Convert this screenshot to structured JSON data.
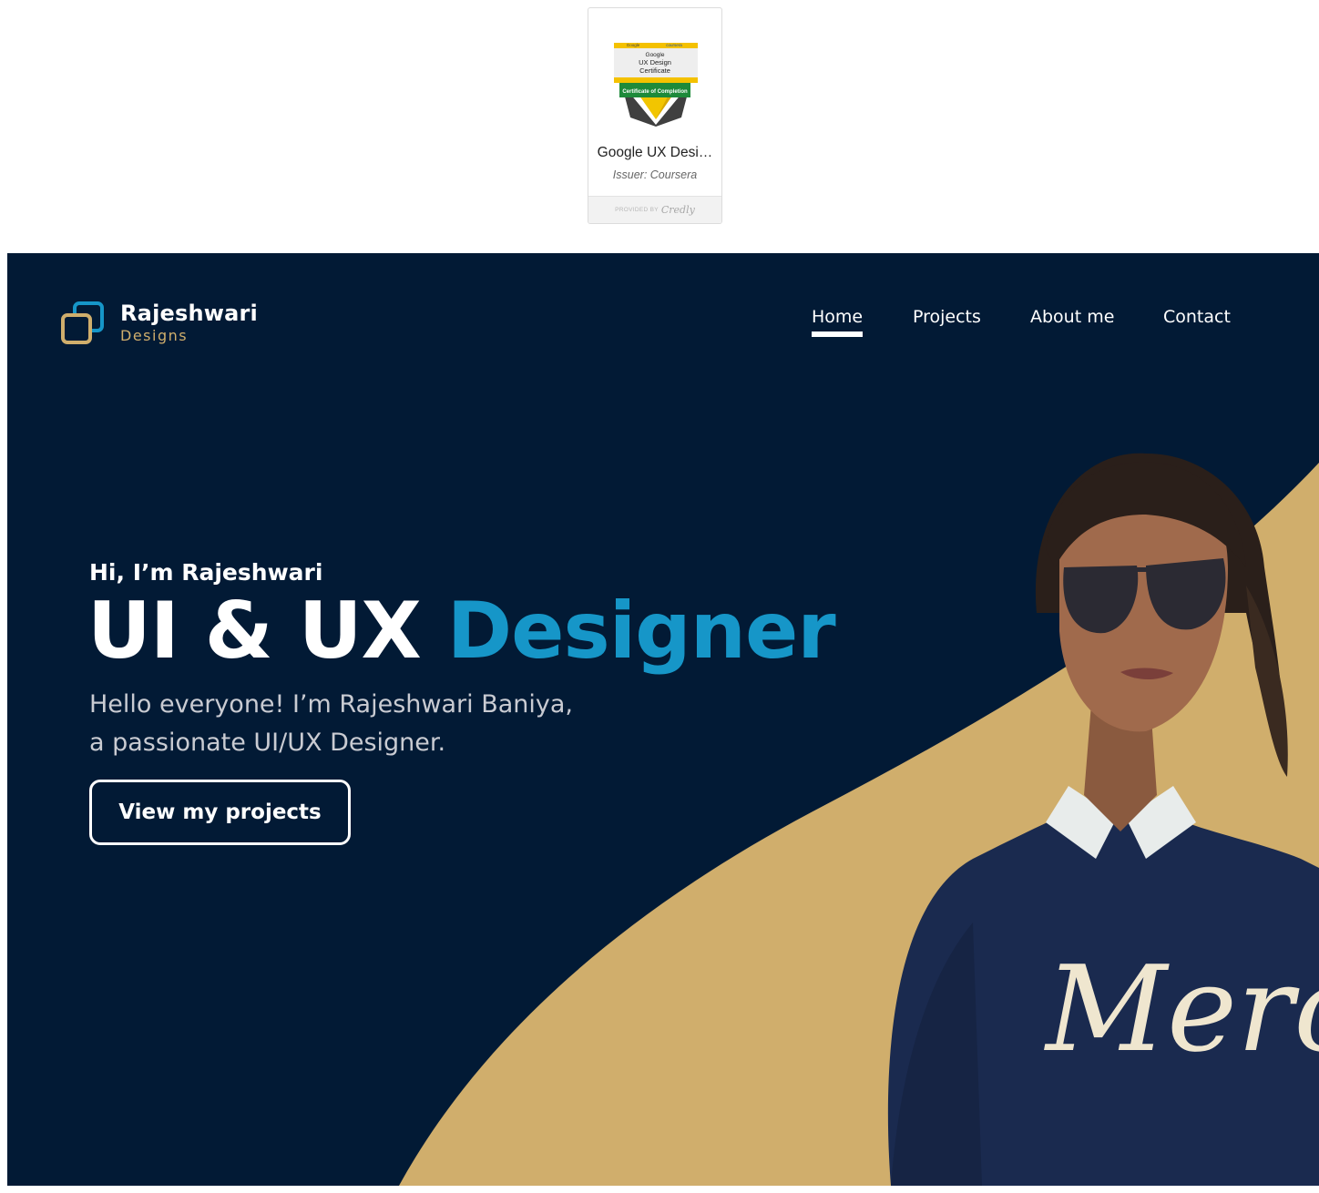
{
  "badge": {
    "image_lines": [
      "Google",
      "coursera",
      "Google",
      "UX Design",
      "Certificate",
      "Certificate of Completion"
    ],
    "name": "Google UX Desi…",
    "issuer": "Issuer: Coursera",
    "provided_by": "PROVIDED BY",
    "provider": "Credly"
  },
  "header": {
    "logo_name": "Rajeshwari",
    "logo_sub": "Designs",
    "nav": [
      {
        "label": "Home",
        "active": true
      },
      {
        "label": "Projects",
        "active": false
      },
      {
        "label": "About me",
        "active": false
      },
      {
        "label": "Contact",
        "active": false
      }
    ]
  },
  "hero": {
    "greeting": "Hi, I’m Rajeshwari",
    "headline_part1": "UI & UX ",
    "headline_part2": "Designer",
    "intro_line1": "Hello everyone! I’m Rajeshwari Baniya,",
    "intro_line2": "a passionate UI/UX Designer.",
    "cta_label": "View my projects",
    "sweater_text": "Merci"
  },
  "colors": {
    "hero_bg": "#021a35",
    "accent_gold": "#d0ae6c",
    "accent_blue": "#1696c8",
    "text_white": "#ffffff"
  },
  "icons": {
    "logo": "overlapping-squares-icon",
    "badge": "certificate-badge-icon"
  }
}
